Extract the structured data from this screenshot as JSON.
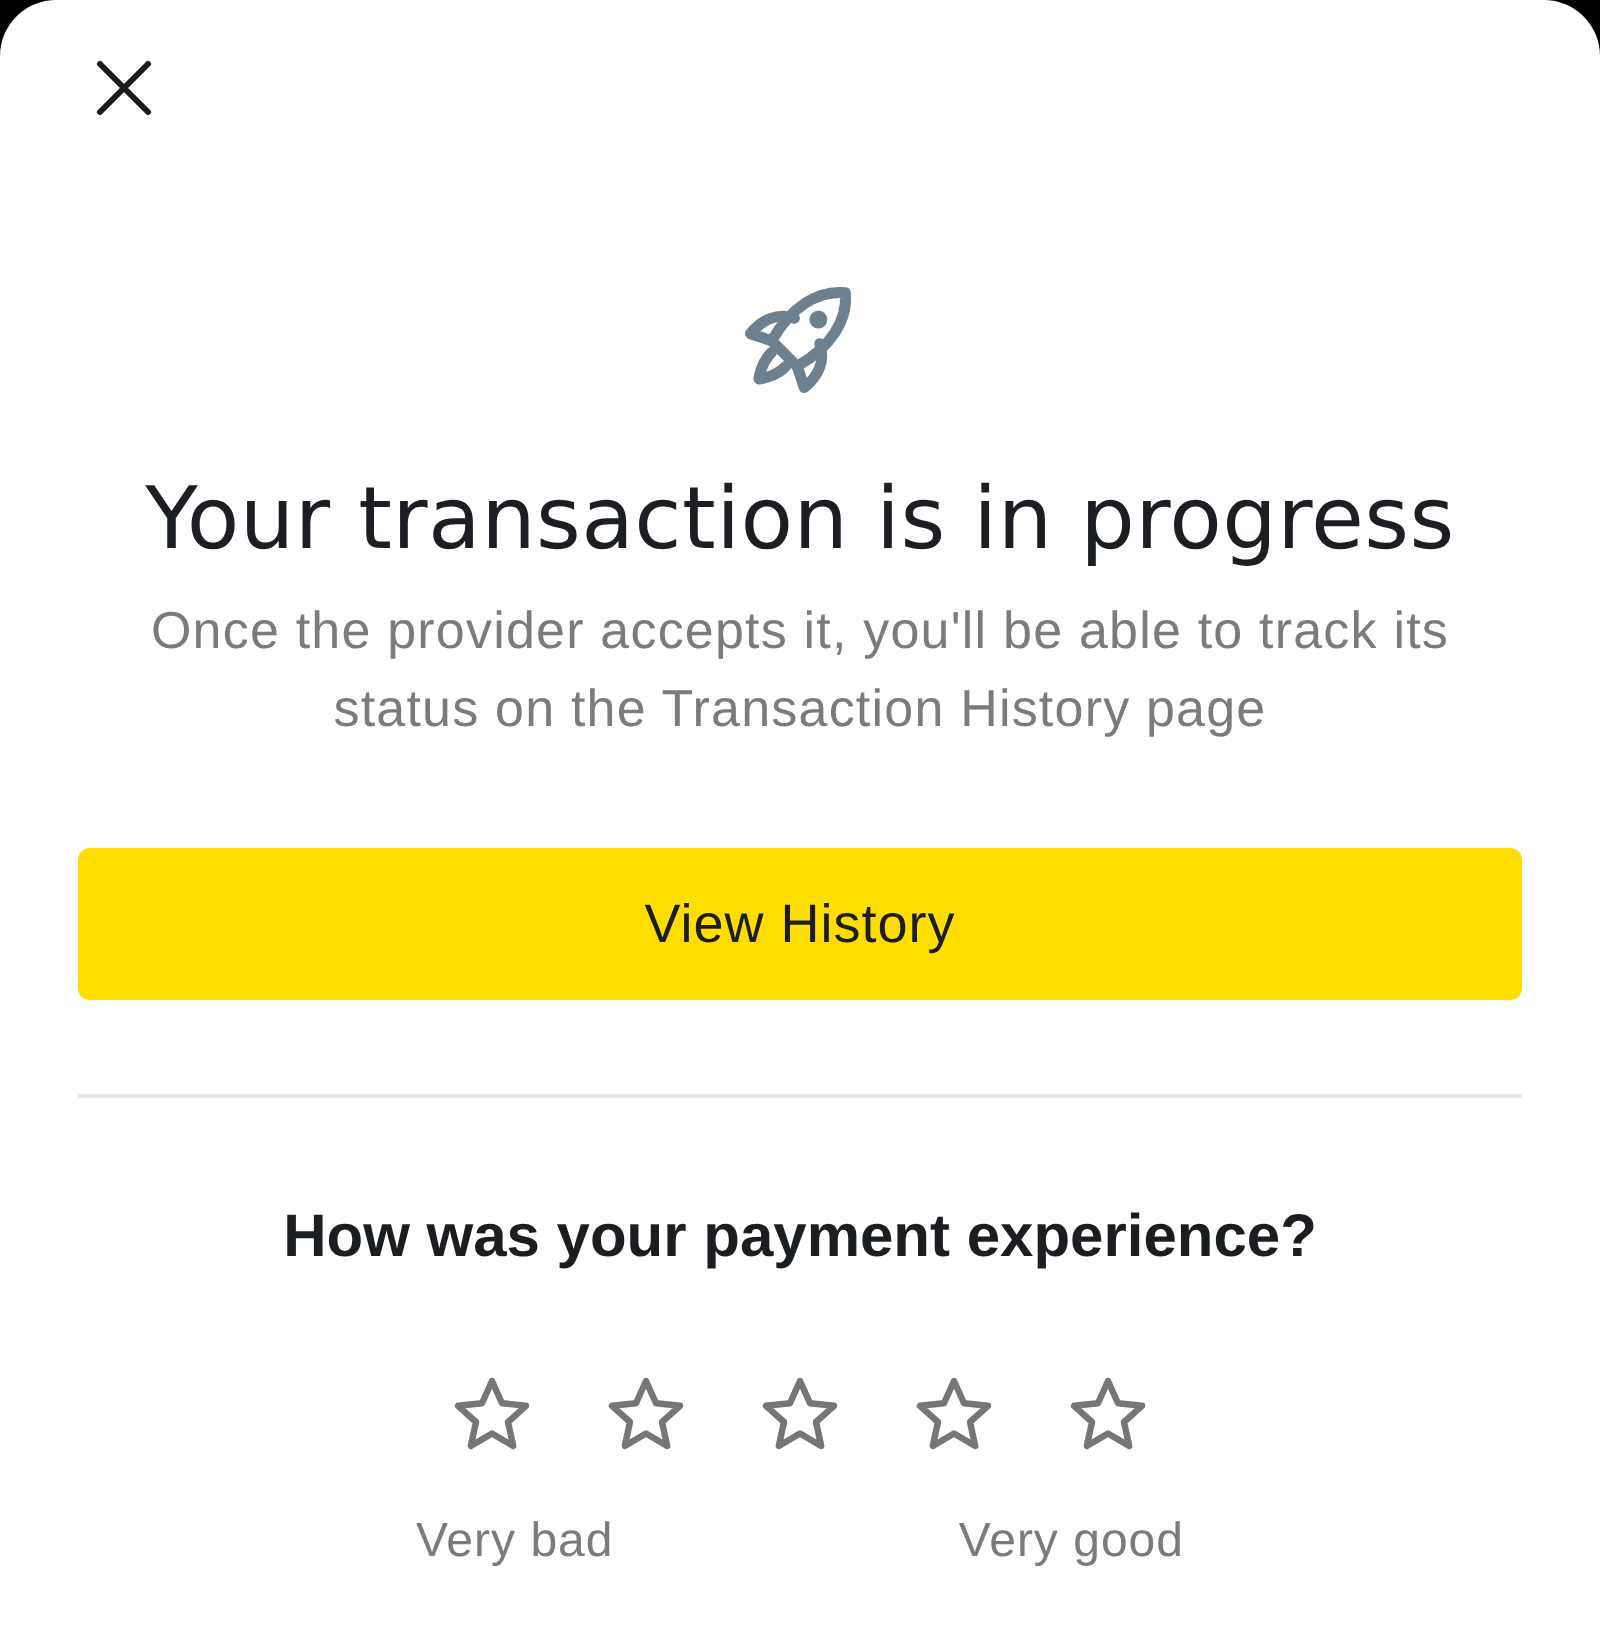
{
  "header": {
    "title": "Your transaction is in progress",
    "message": "Once the provider accepts it, you'll be able to track its status on the Transaction History page"
  },
  "primary_button": {
    "label": "View History"
  },
  "rating": {
    "question": "How was your payment experience?",
    "stars": 0,
    "low_label": "Very bad",
    "high_label": "Very good"
  }
}
